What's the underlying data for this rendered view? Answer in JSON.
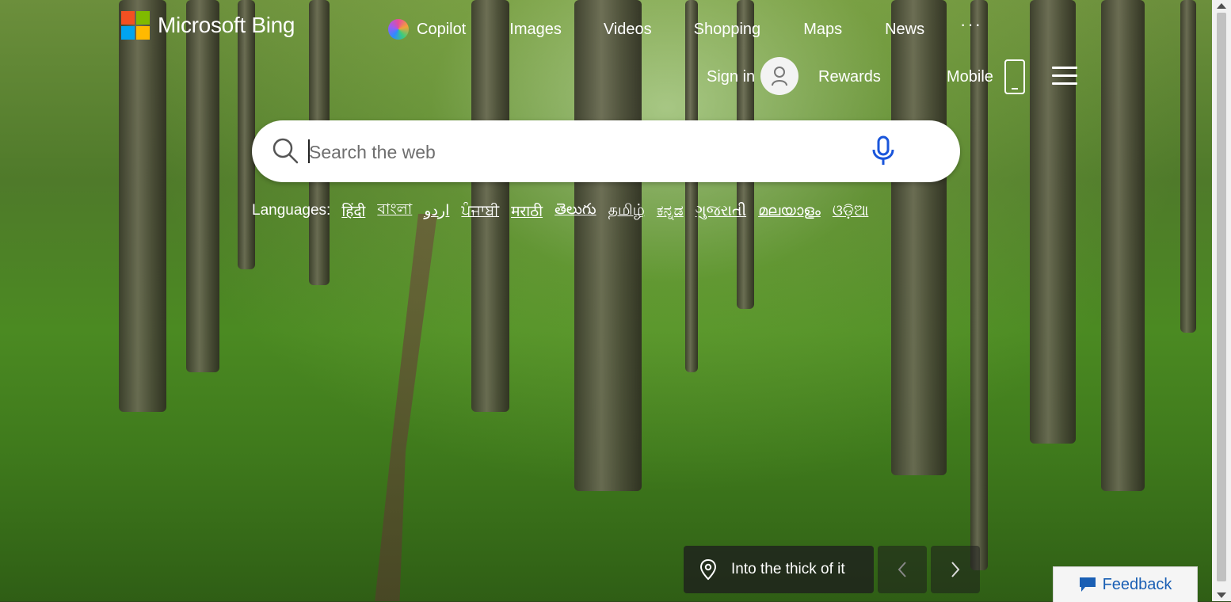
{
  "header": {
    "brand": "Microsoft Bing",
    "nav": [
      {
        "label": "Copilot",
        "icon": "copilot-icon"
      },
      {
        "label": "Images"
      },
      {
        "label": "Videos"
      },
      {
        "label": "Shopping"
      },
      {
        "label": "Maps"
      },
      {
        "label": "News"
      }
    ],
    "more": "···",
    "sign_in": "Sign in",
    "rewards": "Rewards",
    "mobile": "Mobile"
  },
  "search": {
    "placeholder": "Search the web",
    "value": ""
  },
  "languages": {
    "label": "Languages:",
    "items": [
      "हिंदी",
      "বাংলা",
      "اردو",
      "ਪੰਜਾਬੀ",
      "मराठी",
      "తెలుగు",
      "தமிழ்",
      "ಕನ್ನಡ",
      "ગુજરાતી",
      "മലയാളം",
      "ଓଡ଼ିଆ"
    ]
  },
  "background_caption": "Into the thick of it",
  "feedback": "Feedback",
  "colors": {
    "logo_red": "#f25022",
    "logo_green": "#7fba00",
    "logo_blue": "#00a4ef",
    "logo_yellow": "#ffb900",
    "mic_blue": "#1a56db",
    "feedback_text": "#1a5fb4"
  }
}
